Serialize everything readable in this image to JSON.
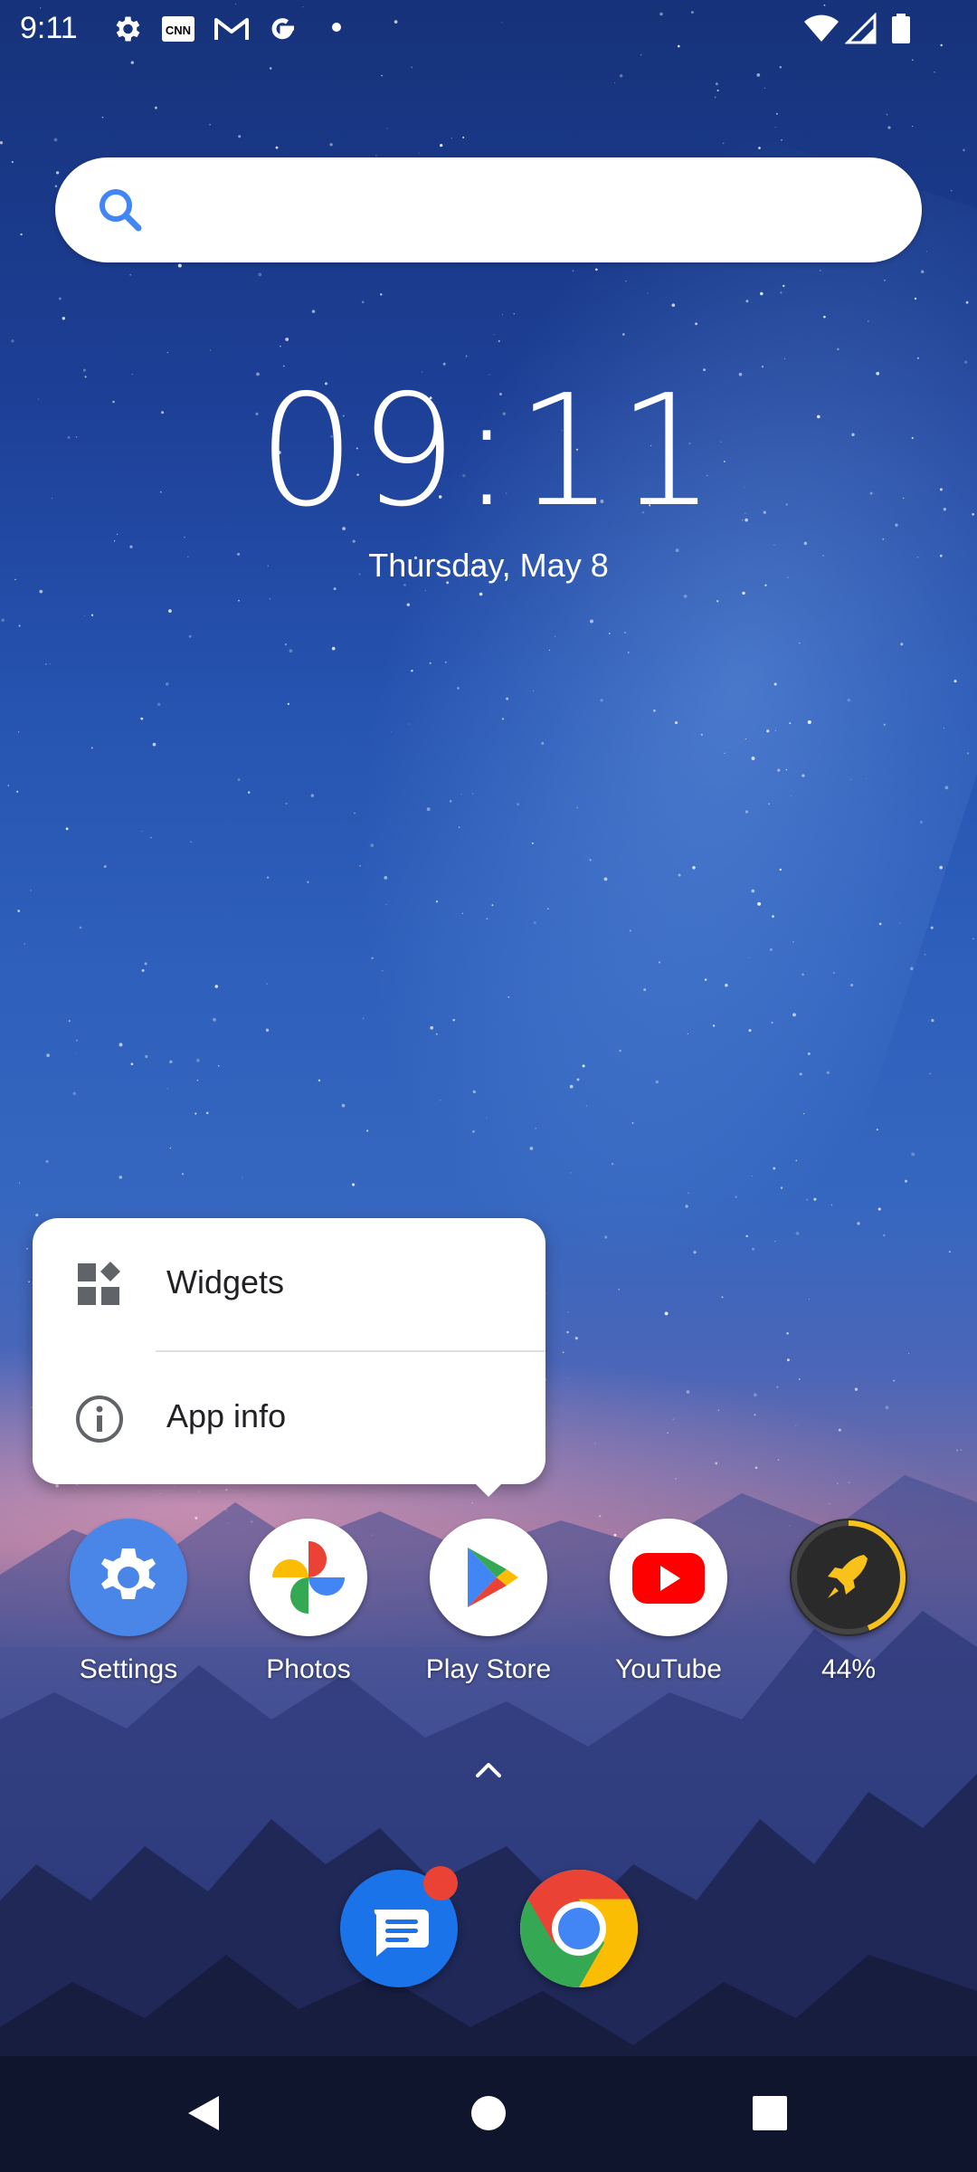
{
  "status_bar": {
    "time": "9:11",
    "icons": [
      "settings-icon",
      "cnn-icon",
      "gmail-icon",
      "google-icon",
      "dot-icon",
      "wifi-icon",
      "signal-icon",
      "battery-icon"
    ]
  },
  "search": {
    "placeholder": ""
  },
  "clock": {
    "time": "09:11",
    "date": "Thursday, May 8"
  },
  "popup_menu": {
    "items": [
      {
        "label": "Widgets",
        "icon": "widgets-icon"
      },
      {
        "label": "App info",
        "icon": "info-icon"
      }
    ]
  },
  "apps": [
    {
      "label": "Settings",
      "icon": "settings-gear-icon"
    },
    {
      "label": "Photos",
      "icon": "photos-pinwheel-icon"
    },
    {
      "label": "Play Store",
      "icon": "play-store-icon"
    },
    {
      "label": "YouTube",
      "icon": "youtube-icon"
    },
    {
      "label": "44%",
      "icon": "rocket-booster-icon",
      "progress": 0.44
    }
  ],
  "dock": [
    {
      "name": "Messages",
      "icon": "messages-icon",
      "badge": true
    },
    {
      "name": "Chrome",
      "icon": "chrome-icon"
    }
  ],
  "colors": {
    "accent_blue": "#4285f4",
    "google_red": "#ea4335",
    "google_yellow": "#fbbc04",
    "google_green": "#34a853",
    "youtube_red": "#ff0000",
    "booster_yellow": "#f9c21b"
  }
}
